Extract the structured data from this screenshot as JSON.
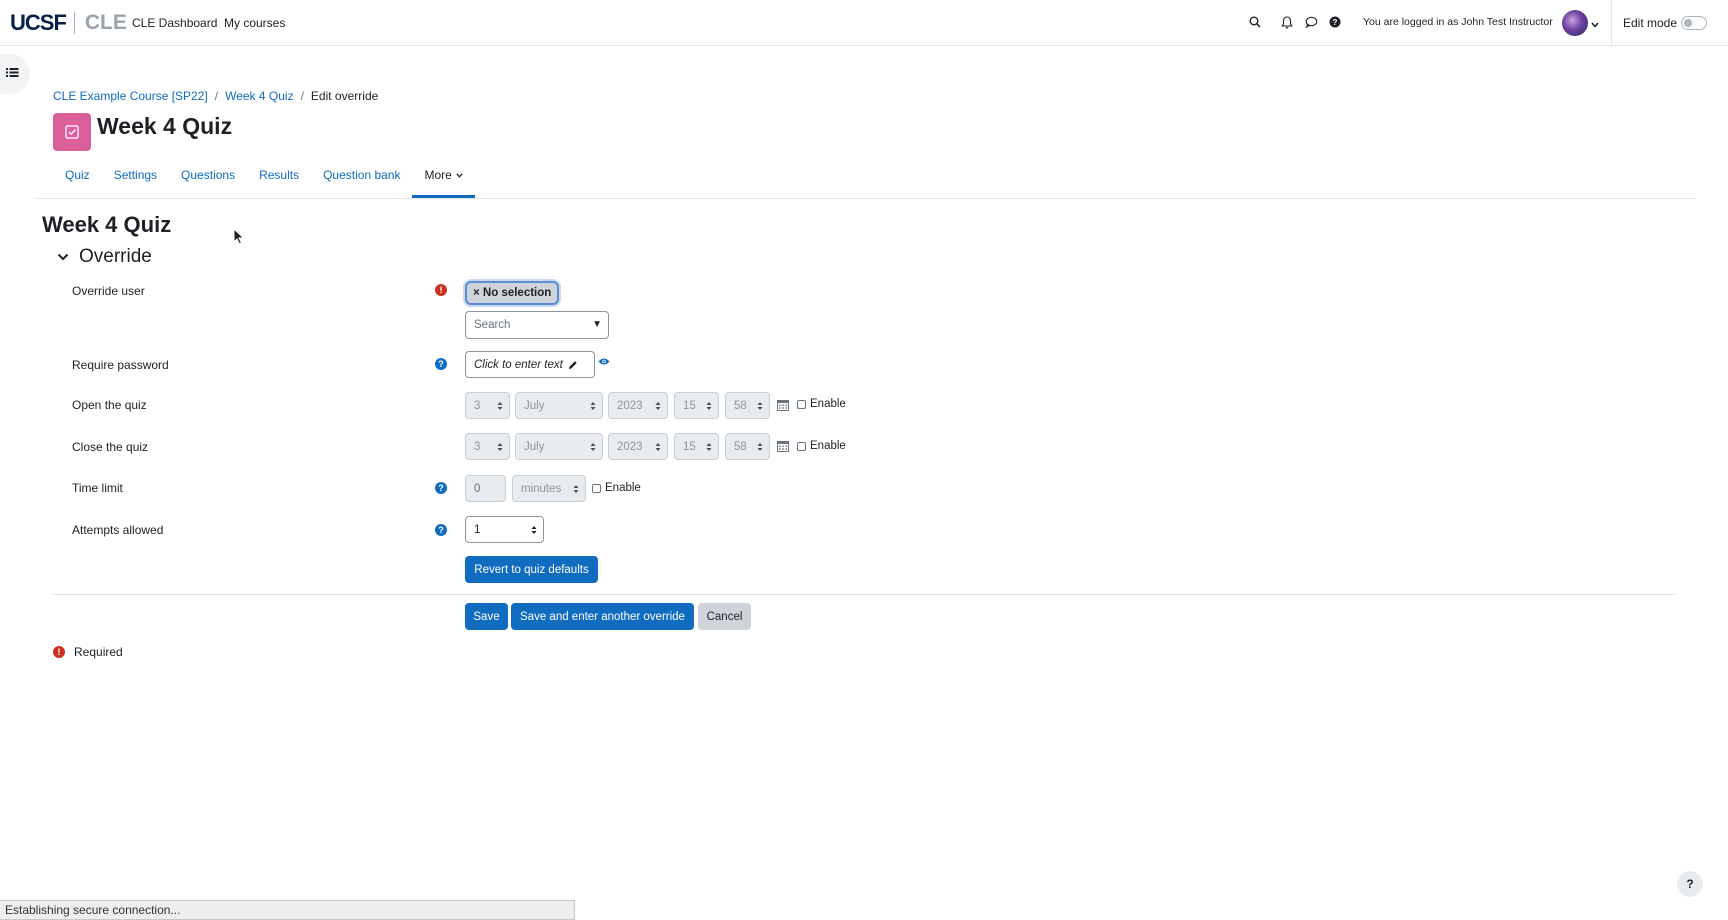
{
  "navbar": {
    "logo_ucsf": "UCSF",
    "logo_cle": "CLE",
    "links": [
      "CLE Dashboard",
      "My courses"
    ],
    "login_text": "You are logged in as John Test Instructor",
    "edit_mode_label": "Edit mode",
    "edit_mode_on": false
  },
  "breadcrumb": {
    "items": [
      "CLE Example Course [SP22]",
      "Week 4 Quiz"
    ],
    "current": "Edit override",
    "separator": "/"
  },
  "header": {
    "title": "Week 4 Quiz",
    "icon_color": "#db5f9b"
  },
  "secondary_nav": {
    "tabs": [
      "Quiz",
      "Settings",
      "Questions",
      "Results",
      "Question bank"
    ],
    "more_label": "More"
  },
  "main": {
    "title": "Week 4 Quiz",
    "section_title": "Override"
  },
  "form": {
    "override_user": {
      "label": "Override user",
      "chip": "× No selection",
      "search_placeholder": "Search"
    },
    "require_password": {
      "label": "Require password",
      "placeholder": "Click to enter text"
    },
    "open_quiz": {
      "label": "Open the quiz",
      "day": "3",
      "month": "July",
      "year": "2023",
      "hour": "15",
      "minute": "58",
      "enable_label": "Enable"
    },
    "close_quiz": {
      "label": "Close the quiz",
      "day": "3",
      "month": "July",
      "year": "2023",
      "hour": "15",
      "minute": "58",
      "enable_label": "Enable"
    },
    "time_limit": {
      "label": "Time limit",
      "value": "0",
      "unit": "minutes",
      "enable_label": "Enable"
    },
    "attempts_allowed": {
      "label": "Attempts allowed",
      "value": "1"
    },
    "revert_button": "Revert to quiz defaults",
    "buttons": {
      "save": "Save",
      "save_another": "Save and enter another override",
      "cancel": "Cancel"
    },
    "required_note": "Required"
  },
  "status_bar": "Establishing secure connection...",
  "help_fab": "?",
  "colors": {
    "link": "#0f6cbf",
    "primary_button": "#0f6cbf",
    "required_icon": "#ca3120"
  }
}
